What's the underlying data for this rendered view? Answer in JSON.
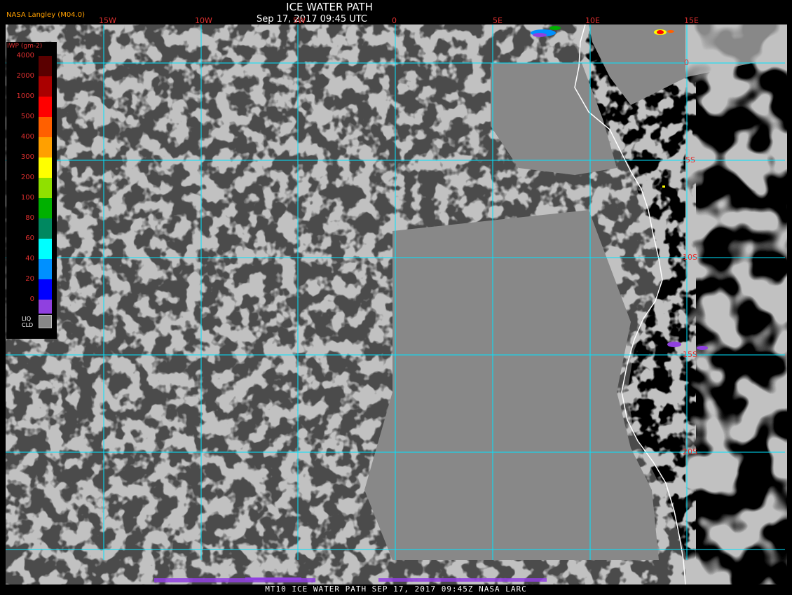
{
  "header": {
    "title": "ICE WATER PATH",
    "subtitle": "Sep 17, 2017 09:45 UTC",
    "credit": "NASA Langley (M04.0)"
  },
  "footer": {
    "text": "MT10  ICE WATER PATH  SEP 17, 2017 09:45Z  NASA LARC"
  },
  "grid": {
    "longitude_labels": [
      "15W",
      "10W",
      "5W",
      "0",
      "5E",
      "10E",
      "15E"
    ],
    "latitude_labels": [
      "0",
      "5S",
      "10S",
      "15S",
      "20S"
    ]
  },
  "legend": {
    "units": "IWP (gm-2)",
    "ticks": [
      "4000",
      "2000",
      "1000",
      "500",
      "400",
      "300",
      "200",
      "100",
      "80",
      "60",
      "40",
      "20",
      "0"
    ],
    "colors": [
      "#5a0000",
      "#aa0000",
      "#ff0000",
      "#ff6000",
      "#ffa000",
      "#ffff00",
      "#90e000",
      "#00b000",
      "#008860",
      "#00ffff",
      "#0090ff",
      "#0000ff",
      "#9040e0"
    ],
    "liquid_cloud_label": [
      "LIQ",
      "CLD"
    ],
    "liquid_cloud_color": "#888888"
  },
  "map_colors": {
    "liquid_cloud": "#888888",
    "clear": "#000000",
    "gridlines": "#00e5ff",
    "coastline": "#ffffff"
  }
}
